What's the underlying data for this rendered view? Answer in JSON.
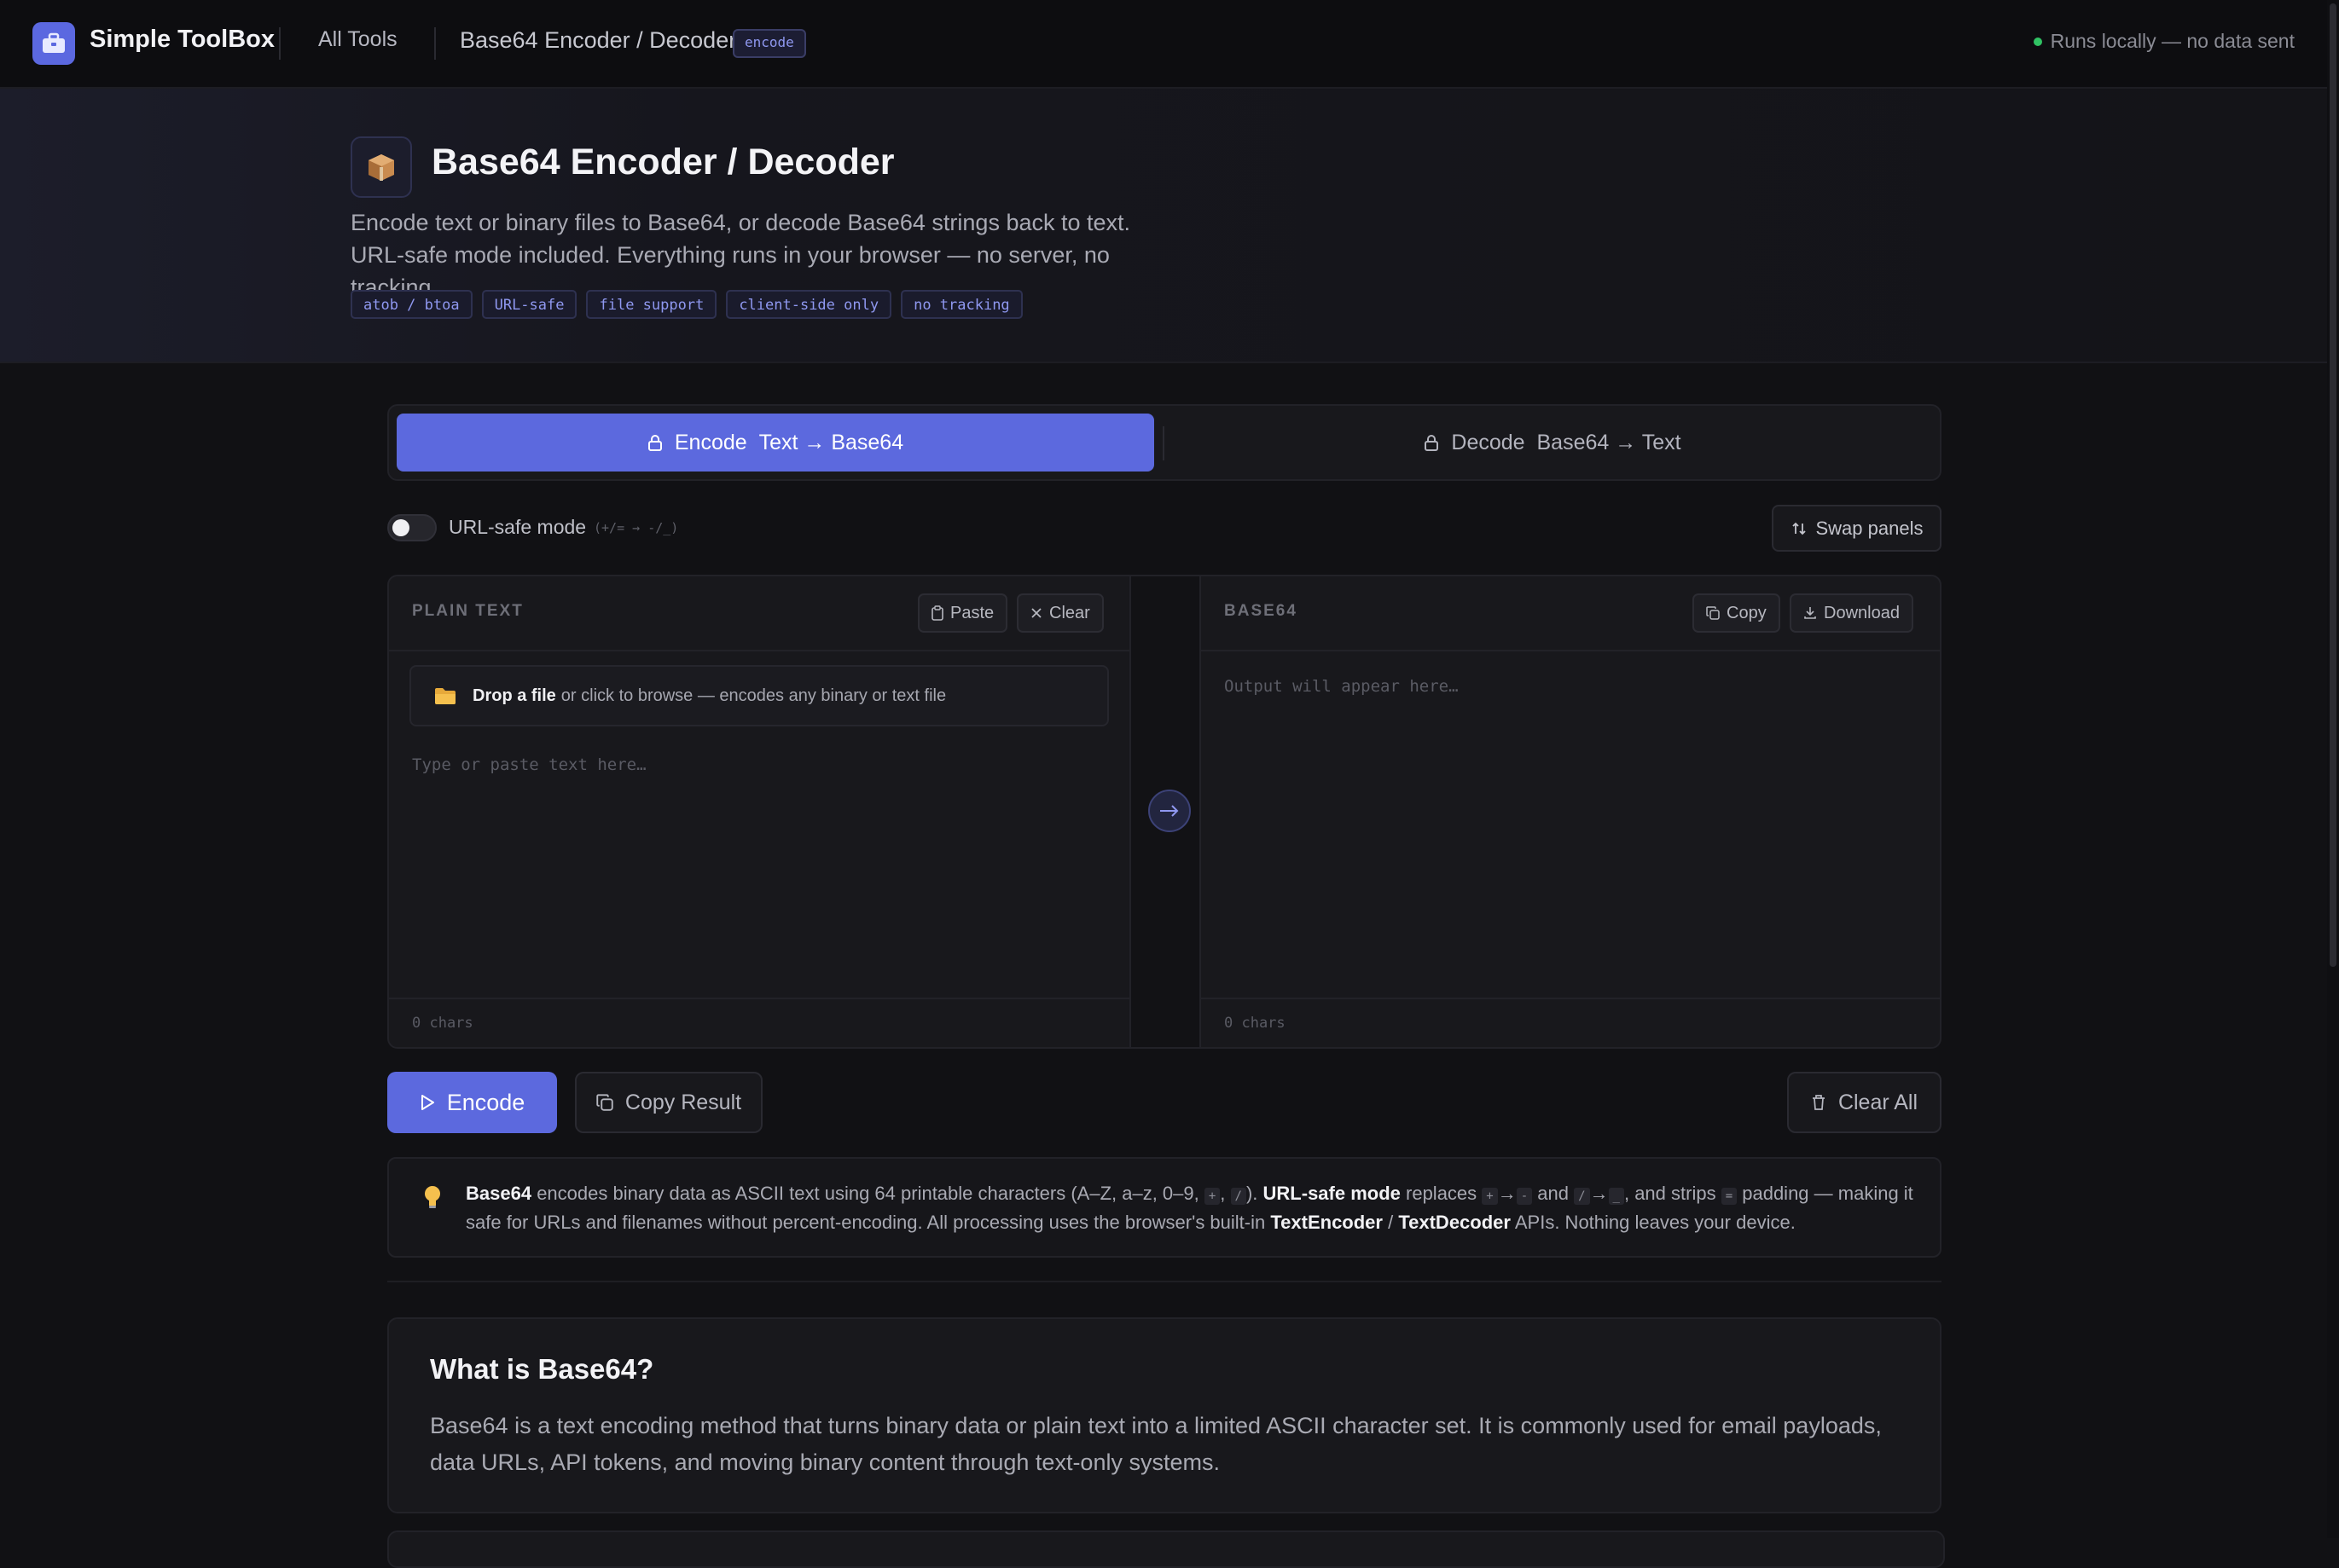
{
  "header": {
    "brand": "Simple ToolBox",
    "nav_all_tools": "All Tools",
    "breadcrumb": "Base64 Encoder / Decoder",
    "badge": "encode",
    "status": "Runs locally — no data sent"
  },
  "hero": {
    "title": "Base64 Encoder / Decoder",
    "description": "Encode text or binary files to Base64, or decode Base64 strings back to text. URL-safe mode included. Everything runs in your browser — no server, no tracking.",
    "tags": [
      "atob / btoa",
      "URL-safe",
      "file support",
      "client-side only",
      "no tracking"
    ]
  },
  "tabs": {
    "encode": {
      "verb": "Encode",
      "desc": "Text → Base64"
    },
    "decode": {
      "verb": "Decode",
      "desc": "Base64 → Text"
    }
  },
  "options": {
    "url_safe_label": "URL-safe mode",
    "url_safe_hint": "(+/= → -/_)",
    "url_safe_on": false,
    "swap_label": "Swap panels"
  },
  "input_panel": {
    "label": "PLAIN TEXT",
    "paste": "Paste",
    "clear": "Clear",
    "drop_strong": "Drop a file",
    "drop_rest": "or click to browse — encodes any binary or text file",
    "placeholder": "Type or paste text here…",
    "count": "0 chars"
  },
  "output_panel": {
    "label": "BASE64",
    "copy": "Copy",
    "download": "Download",
    "placeholder": "Output will appear here…",
    "count": "0 chars"
  },
  "actions": {
    "encode": "Encode",
    "copy_result": "Copy Result",
    "clear_all": "Clear All"
  },
  "info": {
    "t1": "Base64",
    "t2": " encodes binary data as ASCII text using 64 printable characters (A–Z, a–z, 0–9, ",
    "k1": "+",
    "t3": ", ",
    "k2": "/",
    "t4": "). ",
    "t5": "URL-safe mode",
    "t6": " replaces ",
    "k3": "+",
    "t7": "→",
    "k4": "-",
    "t8": " and ",
    "k5": "/",
    "t9": "→",
    "k6": "_",
    "t10": ", and strips ",
    "k7": "=",
    "t11": " padding — making it safe for URLs and filenames without percent-encoding. All processing uses the browser's built-in ",
    "t12": "TextEncoder",
    "t13": " / ",
    "t14": "TextDecoder",
    "t15": " APIs. Nothing leaves your device."
  },
  "article": {
    "title": "What is Base64?",
    "body": "Base64 is a text encoding method that turns binary data or plain text into a limited ASCII character set. It is commonly used for email payloads, data URLs, API tokens, and moving binary content through text-only systems."
  },
  "colors": {
    "accent": "#5c69de",
    "background": "#111114",
    "status_dot": "#30c263"
  }
}
